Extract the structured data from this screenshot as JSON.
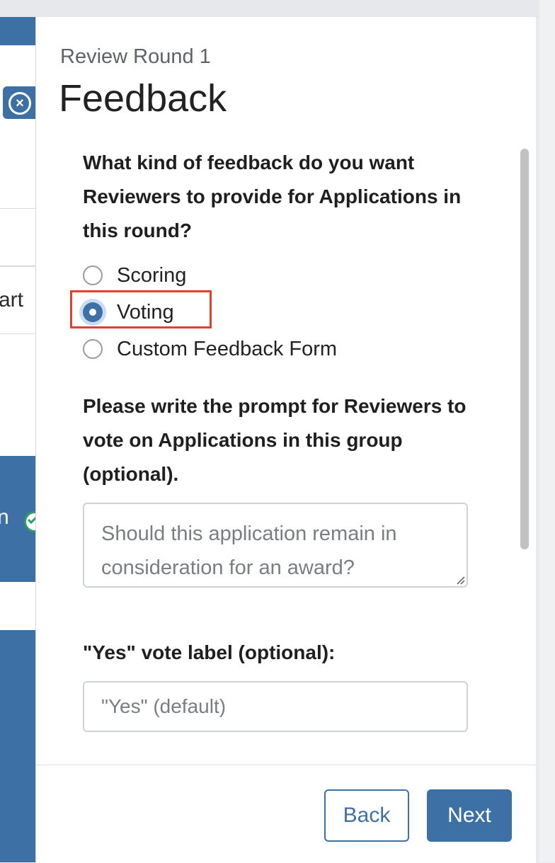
{
  "background": {
    "partial_texts": [
      "art",
      "n"
    ]
  },
  "header": {
    "subtitle": "Review Round 1",
    "title": "Feedback"
  },
  "feedback_question": "What kind of feedback do you want Reviewers to provide for Applications in this round?",
  "feedback_options": [
    {
      "label": "Scoring",
      "selected": false
    },
    {
      "label": "Voting",
      "selected": true
    },
    {
      "label": "Custom Feedback Form",
      "selected": false
    }
  ],
  "prompt_question": "Please write the prompt for Reviewers to vote on Applications in this group (optional).",
  "prompt_field": {
    "value": "",
    "placeholder": "Should this application remain in consideration for an award?"
  },
  "yes_label_question": "\"Yes\" vote label (optional):",
  "yes_label_field": {
    "value": "",
    "placeholder": "\"Yes\" (default)"
  },
  "footer": {
    "back_label": "Back",
    "next_label": "Next"
  },
  "colors": {
    "accent": "#3d71a5",
    "highlight": "#e0412c",
    "success": "#2f9a67"
  }
}
